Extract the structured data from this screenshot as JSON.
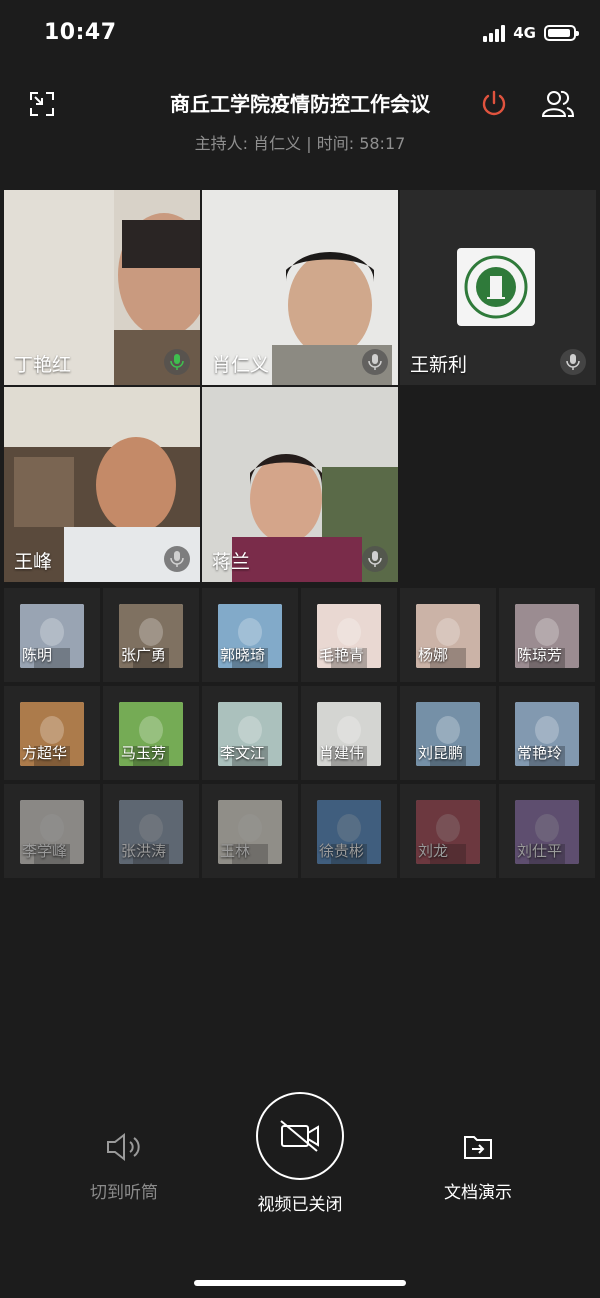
{
  "status": {
    "time": "10:47",
    "network": "4G",
    "battery_level": 0.9
  },
  "meeting": {
    "title": "商丘工学院疫情防控工作会议",
    "subtitle": "主持人: 肖仁义 | 时间: 58:17"
  },
  "colors": {
    "background": "#1c1c1c",
    "power_red": "#e0533e",
    "mic_active_green": "#3fbf4f",
    "secondary_text": "#8f8f8f"
  },
  "icons": {
    "minimize": "minimize-window-icon",
    "power": "power-icon",
    "participants": "participants-icon",
    "mic": "microphone-icon",
    "speaker": "speaker-icon",
    "camera_off": "camera-off-icon",
    "share_doc": "share-document-icon"
  },
  "video_tiles": [
    {
      "name": "丁艳红",
      "mic_active": true,
      "bg": "#d8d2c8",
      "skin": "#c99a7f"
    },
    {
      "name": "肖仁义",
      "mic_active": false,
      "bg": "#e8e8e6",
      "skin": "#d0a88c"
    },
    {
      "name": "王新利",
      "mic_active": false,
      "bg": "#2a2a2a",
      "logo": true
    },
    {
      "name": "王峰",
      "mic_active": false,
      "bg": "#5a4a3c",
      "skin": "#c48a68"
    },
    {
      "name": "蒋兰",
      "mic_active": false,
      "bg": "#d6d6d2",
      "skin": "#d4a58a"
    }
  ],
  "participants": [
    {
      "name": "陈明",
      "color": "#8a96a8",
      "dim": false
    },
    {
      "name": "张广勇",
      "color": "#6b5a48",
      "dim": false
    },
    {
      "name": "郭晓琦",
      "color": "#6f9ec2",
      "dim": false
    },
    {
      "name": "毛艳青",
      "color": "#e7d3cc",
      "dim": false
    },
    {
      "name": "杨娜",
      "color": "#c4a89a",
      "dim": false
    },
    {
      "name": "陈琼芳",
      "color": "#8c7a80",
      "dim": false
    },
    {
      "name": "方超华",
      "color": "#a0662e",
      "dim": false
    },
    {
      "name": "马玉芳",
      "color": "#5f9f3a",
      "dim": false
    },
    {
      "name": "李文江",
      "color": "#9fb8b4",
      "dim": false
    },
    {
      "name": "肖建伟",
      "color": "#cfd0cc",
      "dim": false
    },
    {
      "name": "刘昆鹏",
      "color": "#5f7f9a",
      "dim": false
    },
    {
      "name": "常艳玲",
      "color": "#6e8aa4",
      "dim": false
    },
    {
      "name": "李学峰",
      "color": "#d9d6d0",
      "dim": true
    },
    {
      "name": "张洪涛",
      "color": "#7c8fa6",
      "dim": true
    },
    {
      "name": "王林",
      "color": "#e8e2d6",
      "dim": true
    },
    {
      "name": "徐贵彬",
      "color": "#3c7cc0",
      "dim": true
    },
    {
      "name": "刘龙",
      "color": "#9a2a3a",
      "dim": true
    },
    {
      "name": "刘仕平",
      "color": "#7b5aa0",
      "dim": true
    }
  ],
  "controls": {
    "speaker_label": "切到听筒",
    "video_label": "视频已关闭",
    "share_label": "文档演示"
  }
}
